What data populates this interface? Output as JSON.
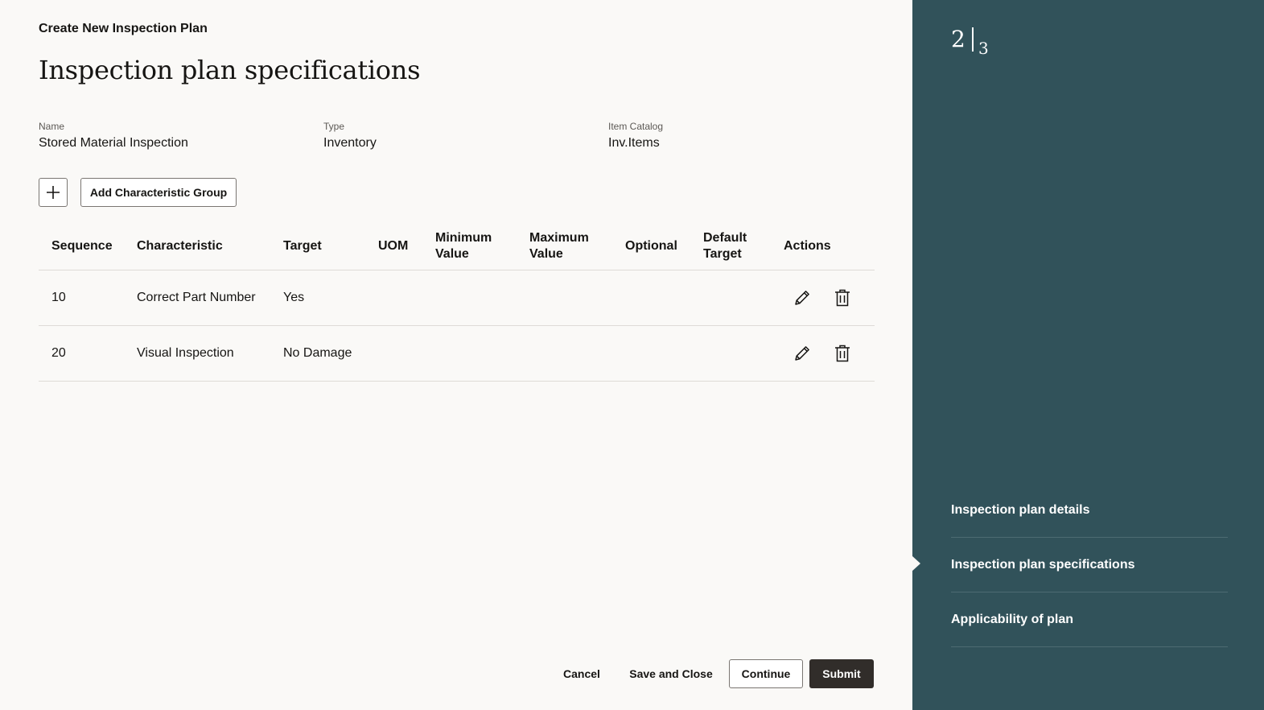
{
  "header": {
    "breadcrumb": "Create New Inspection Plan",
    "title": "Inspection plan specifications"
  },
  "summary": {
    "name_label": "Name",
    "name_value": "Stored Material Inspection",
    "type_label": "Type",
    "type_value": "Inventory",
    "catalog_label": "Item Catalog",
    "catalog_value": "Inv.Items"
  },
  "toolbar": {
    "add_icon": "plus-icon",
    "add_group_label": "Add Characteristic Group"
  },
  "table": {
    "columns": [
      "Sequence",
      "Characteristic",
      "Target",
      "UOM",
      "Minimum Value",
      "Maximum Value",
      "Optional",
      "Default Target",
      "Actions"
    ],
    "rows": [
      {
        "sequence": "10",
        "characteristic": "Correct Part Number",
        "target": "Yes",
        "uom": "",
        "min": "",
        "max": "",
        "optional": "",
        "default_target": ""
      },
      {
        "sequence": "20",
        "characteristic": "Visual Inspection",
        "target": "No Damage",
        "uom": "",
        "min": "",
        "max": "",
        "optional": "",
        "default_target": ""
      }
    ],
    "action_icons": [
      "pencil-icon",
      "trash-icon"
    ]
  },
  "footer": {
    "cancel": "Cancel",
    "save_close": "Save and Close",
    "continue": "Continue",
    "submit": "Submit"
  },
  "sidebar": {
    "current_step": "2",
    "total_steps": "3",
    "steps": [
      {
        "label": "Inspection plan details"
      },
      {
        "label": "Inspection plan specifications"
      },
      {
        "label": "Applicability of plan"
      }
    ]
  },
  "colors": {
    "sidebar_bg": "#31525a",
    "primary_button": "#312d2a",
    "page_bg": "#faf9f7"
  }
}
